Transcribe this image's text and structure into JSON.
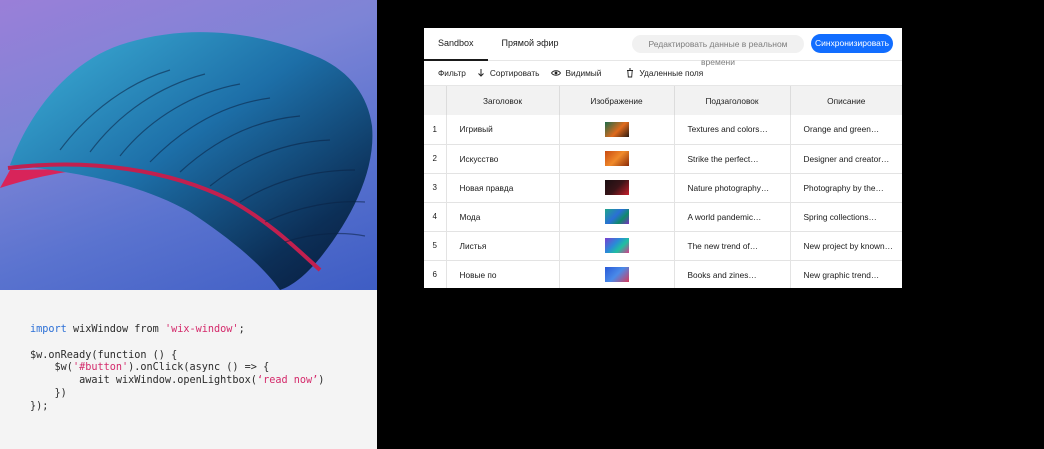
{
  "code": {
    "import_kw": "import",
    "import_name": " wixWindow from ",
    "import_str": "'wix-window'",
    "import_end": ";",
    "line2": "$w.onReady(function () {",
    "line3_pre": "    $w(",
    "line3_str": "'#button'",
    "line3_post": ").onClick(async () => {",
    "line4_pre": "        await wixWindow.openLightbox(",
    "line4_str": "‘read now’",
    "line4_post": ")",
    "line5": "    })",
    "line6": "});"
  },
  "cms": {
    "tabs": [
      {
        "label": "Sandbox",
        "active": true
      },
      {
        "label": "Прямой эфир",
        "active": false
      }
    ],
    "live_edit_label": "Редактировать данные в реальном времени",
    "sync_label": "Синхронизировать",
    "toolbar": {
      "filter": "Фильтр",
      "sort": "Сортировать",
      "visible": "Видимый",
      "deleted": "Удаленные поля"
    },
    "columns": [
      "Заголовок",
      "Изображение",
      "Подзаголовок",
      "Описание"
    ],
    "rows": [
      {
        "num": "1",
        "title": "Игривый",
        "subtitle": "Textures and colors…",
        "description": "Orange and green…"
      },
      {
        "num": "2",
        "title": "Искусство",
        "subtitle": "Strike the perfect…",
        "description": "Designer and creator…"
      },
      {
        "num": "3",
        "title": "Новая правда",
        "subtitle": "Nature photography…",
        "description": "Photography by the…"
      },
      {
        "num": "4",
        "title": "Мода",
        "subtitle": "A world pandemic…",
        "description": "Spring collections…"
      },
      {
        "num": "5",
        "title": "Листья",
        "subtitle": "The new trend of…",
        "description": "New project by known…"
      },
      {
        "num": "6",
        "title": "Новые по",
        "subtitle": "Books and zines…",
        "description": "New graphic trend…"
      }
    ]
  },
  "colors": {
    "accent": "#116dff",
    "code_keyword": "#2b6fd6",
    "code_string": "#d42a6b"
  }
}
